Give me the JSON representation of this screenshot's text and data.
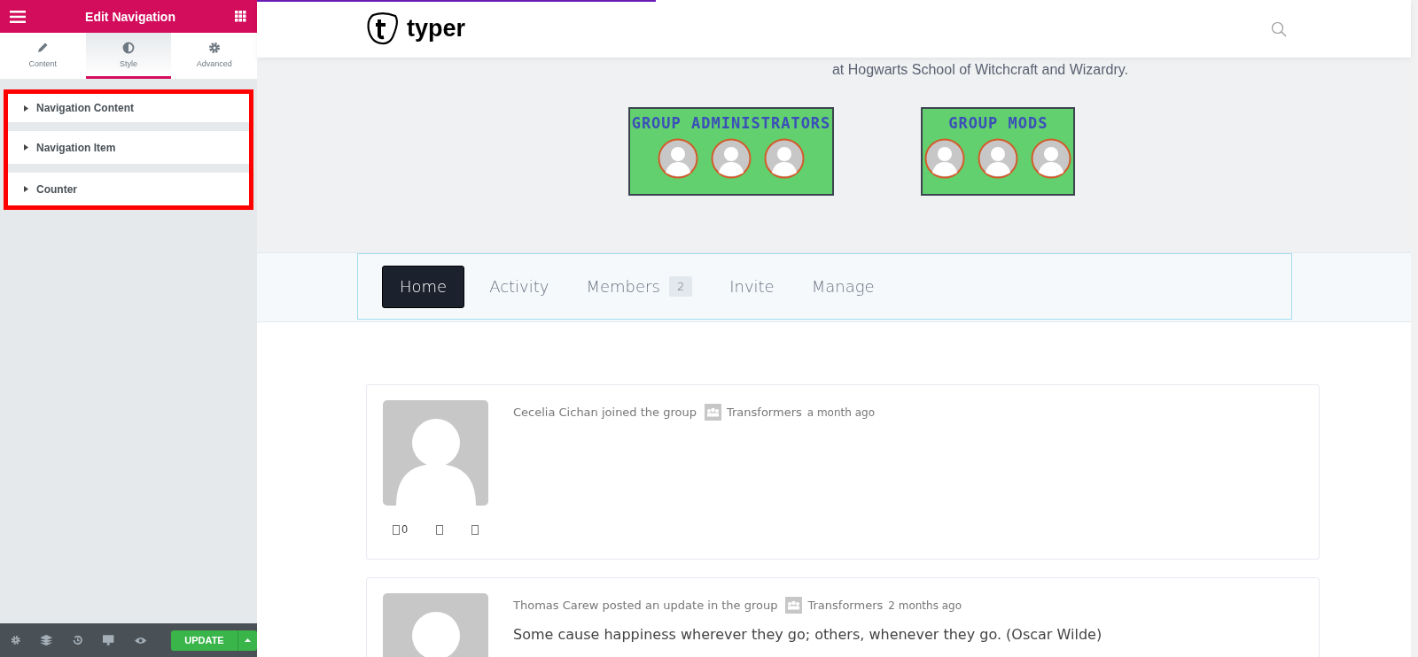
{
  "editor": {
    "title": "Edit Navigation",
    "tabs": [
      {
        "label": "Content",
        "selected": false
      },
      {
        "label": "Style",
        "selected": true
      },
      {
        "label": "Advanced",
        "selected": false
      }
    ],
    "sections": [
      {
        "label": "Navigation Content",
        "highlighted": true
      },
      {
        "label": "Navigation Item",
        "highlighted": true
      },
      {
        "label": "Counter",
        "highlighted": true
      }
    ],
    "update_button": "UPDATE"
  },
  "site": {
    "logo": "typer",
    "subtitle": "at Hogwarts School of Witchcraft and Wizardry.",
    "groups": [
      {
        "title": "GROUP ADMINISTRATORS"
      },
      {
        "title": "GROUP MODS"
      }
    ],
    "nav": [
      {
        "label": "Home",
        "selected": true
      },
      {
        "label": "Activity",
        "selected": false
      },
      {
        "label": "Members",
        "selected": false,
        "count": "2"
      },
      {
        "label": "Invite",
        "selected": false
      },
      {
        "label": "Manage",
        "selected": false
      }
    ],
    "activities": [
      {
        "action": "Cecelia Cichan joined the group",
        "group": "Transformers",
        "time": "a month ago",
        "comment_count": "0"
      },
      {
        "action": "Thomas Carew posted an update in the group",
        "group": "Transformers",
        "time": "2 months ago",
        "body": "Some cause happiness wherever they go; others, whenever they go. (Oscar Wilde)"
      }
    ]
  }
}
